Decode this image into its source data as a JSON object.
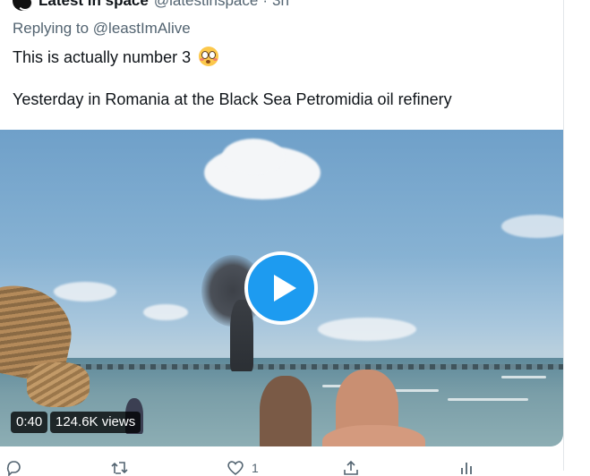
{
  "tweet": {
    "display_name": "Latest in space",
    "handle": "@latestinspace",
    "separator": "·",
    "time": "3h",
    "replying_prefix": "Replying to",
    "replying_to": "@leastImAlive",
    "text_line1": "This is actually number 3",
    "text_line2": "Yesterday in Romania at the Black Sea Petromidia oil refinery"
  },
  "video": {
    "duration": "0:40",
    "views": "124.6K views"
  },
  "actions": {
    "like_count": "1"
  },
  "colors": {
    "accent": "#1d9bf0",
    "text": "#0f1419",
    "secondary": "#536471"
  }
}
